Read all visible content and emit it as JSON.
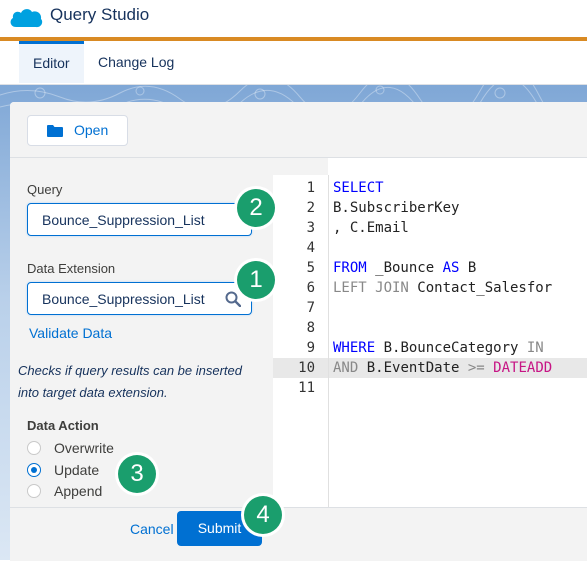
{
  "app": {
    "title": "Query Studio",
    "logo": "salesforce-cloud-logo",
    "brand_color": "#00a1e0",
    "accent_color": "#d98a23"
  },
  "tabs": [
    {
      "label": "Editor",
      "active": true
    },
    {
      "label": "Change Log",
      "active": false
    }
  ],
  "toolbar": {
    "open_label": "Open",
    "open_icon": "folder-icon"
  },
  "form": {
    "query_label": "Query",
    "query_value": "Bounce_Suppression_List",
    "de_label": "Data Extension",
    "de_value": "Bounce_Suppression_List",
    "de_icon": "search-icon",
    "validate_label": "Validate Data",
    "help_text": "Checks if query results can be inserted into target data extension.",
    "data_action_label": "Data Action",
    "data_actions": [
      {
        "label": "Overwrite",
        "checked": false
      },
      {
        "label": "Update",
        "checked": true
      },
      {
        "label": "Append",
        "checked": false
      }
    ],
    "cancel_label": "Cancel",
    "submit_label": "Submit"
  },
  "editor": {
    "active_line": 10,
    "lines": [
      {
        "n": "1",
        "tokens": [
          {
            "t": "SELECT",
            "c": "kw"
          }
        ]
      },
      {
        "n": "2",
        "tokens": [
          {
            "t": "B.SubscriberKey",
            "c": "pl"
          }
        ]
      },
      {
        "n": "3",
        "tokens": [
          {
            "t": ", C.Email",
            "c": "pl"
          }
        ]
      },
      {
        "n": "4",
        "tokens": []
      },
      {
        "n": "5",
        "tokens": [
          {
            "t": "FROM",
            "c": "kw"
          },
          {
            "t": " _Bounce ",
            "c": "pl"
          },
          {
            "t": "AS",
            "c": "kw"
          },
          {
            "t": " B",
            "c": "pl"
          }
        ]
      },
      {
        "n": "6",
        "tokens": [
          {
            "t": "LEFT JOIN",
            "c": "kwg"
          },
          {
            "t": " Contact_Salesfor",
            "c": "pl"
          }
        ]
      },
      {
        "n": "7",
        "tokens": []
      },
      {
        "n": "8",
        "tokens": []
      },
      {
        "n": "9",
        "tokens": [
          {
            "t": "WHERE",
            "c": "kw"
          },
          {
            "t": " B.BounceCategory ",
            "c": "pl"
          },
          {
            "t": "IN",
            "c": "kwg"
          }
        ]
      },
      {
        "n": "10",
        "tokens": [
          {
            "t": "AND",
            "c": "kwg"
          },
          {
            "t": " B.EventDate ",
            "c": "pl"
          },
          {
            "t": ">=",
            "c": "kwg"
          },
          {
            "t": " ",
            "c": "pl"
          },
          {
            "t": "DATEADD",
            "c": "fn"
          }
        ]
      },
      {
        "n": "11",
        "tokens": []
      }
    ]
  },
  "badges": [
    "2",
    "1",
    "3",
    "4"
  ],
  "badge_color": "#1a9e6d"
}
